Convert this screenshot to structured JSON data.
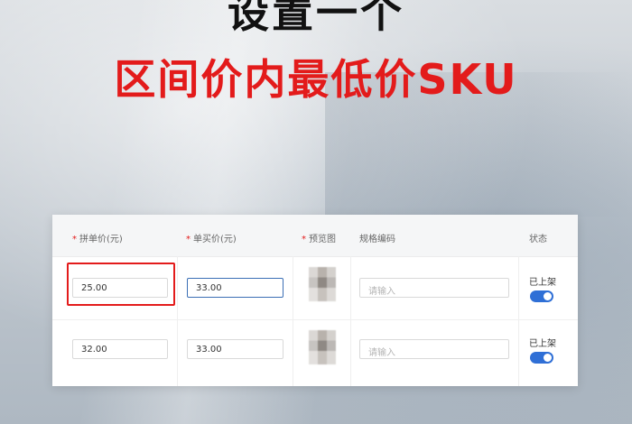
{
  "headline": {
    "line1": "设置一个",
    "line2": "区间价内最低价SKU"
  },
  "table": {
    "required_mark": "*",
    "headers": {
      "group_price": "拼单价(元)",
      "single_price": "单买价(元)",
      "preview": "预览图",
      "spec_code": "规格编码",
      "status": "状态"
    },
    "rows": [
      {
        "group_price": "25.00",
        "single_price": "33.00",
        "spec_code_placeholder": "请输入",
        "status_label": "已上架",
        "status_on": true
      },
      {
        "group_price": "32.00",
        "single_price": "33.00",
        "spec_code_placeholder": "请输入",
        "status_label": "已上架",
        "status_on": true
      }
    ]
  },
  "colors": {
    "headline_red": "#e31b1b",
    "toggle_on": "#2f6fd6",
    "highlight_box": "#e31b1b"
  }
}
